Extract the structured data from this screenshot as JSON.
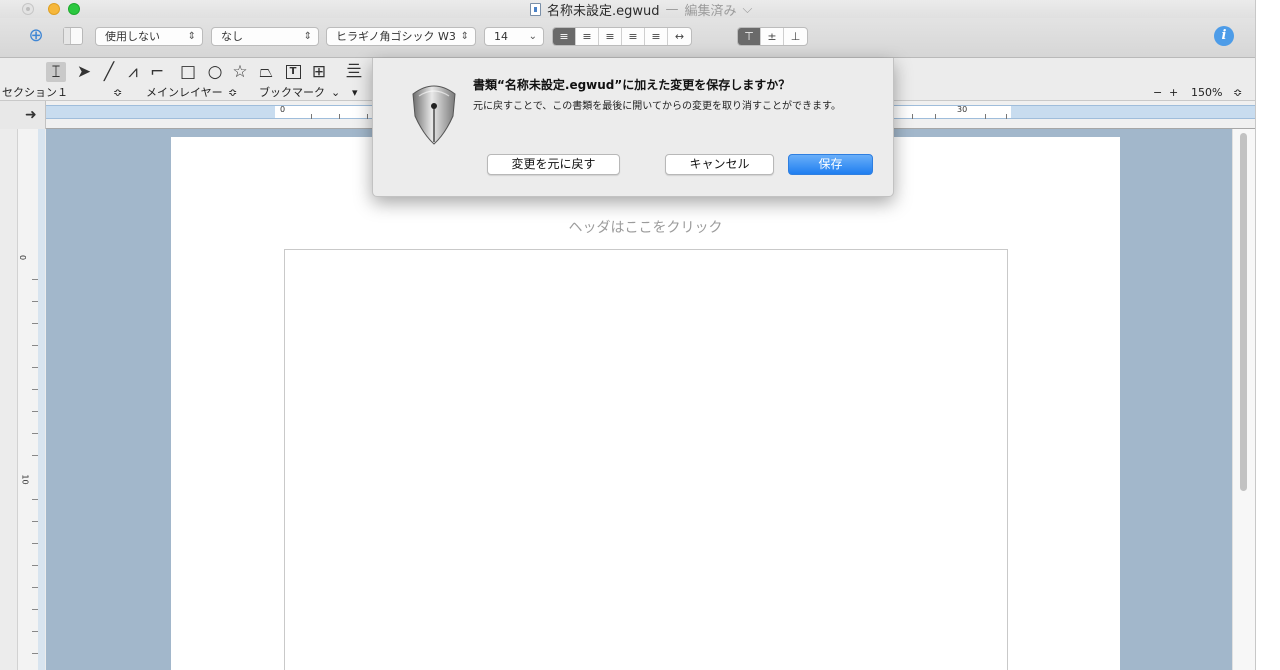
{
  "window": {
    "title": "名称未設定.egwud",
    "separator": "—",
    "status": "編集済み",
    "status_chevron": "⌵"
  },
  "toolbar": {
    "wrap_select": "使用しない",
    "line_select": "なし",
    "font_select": "ヒラギノ角ゴシック W3",
    "size_select": "14",
    "updown_glyph": "⇕",
    "chevron_glyph": "⌄",
    "info_glyph": "i"
  },
  "section_bar": {
    "section_label": "セクション１",
    "layer_label": "メインレイヤー",
    "bookmark_label": "ブックマーク",
    "updown_glyph": "≎",
    "chevron_glyph": "⌄",
    "triangle_glyph": "▾",
    "zoom_out": "−",
    "zoom_in": "+",
    "zoom_level": "150%"
  },
  "ruler": {
    "start_label": "0",
    "end_label": "30"
  },
  "vruler": {
    "label_0": "0",
    "label_10": "10"
  },
  "page": {
    "header_hint": "ヘッダはここをクリック"
  },
  "dialog": {
    "title": "書類“名称未設定.egwud”に加えた変更を保存しますか？",
    "message": "元に戻すことで、この書類を最後に開いてからの変更を取り消すことができます。",
    "revert_button": "変更を元に戻す",
    "cancel_button": "キャンセル",
    "save_button": "保存"
  },
  "colors": {
    "accent": "#1f7ef0",
    "canvas_bg": "#a2b7cb",
    "close": "#e3e3e3",
    "minimize": "#f6b73b",
    "maximize": "#2bc840"
  }
}
